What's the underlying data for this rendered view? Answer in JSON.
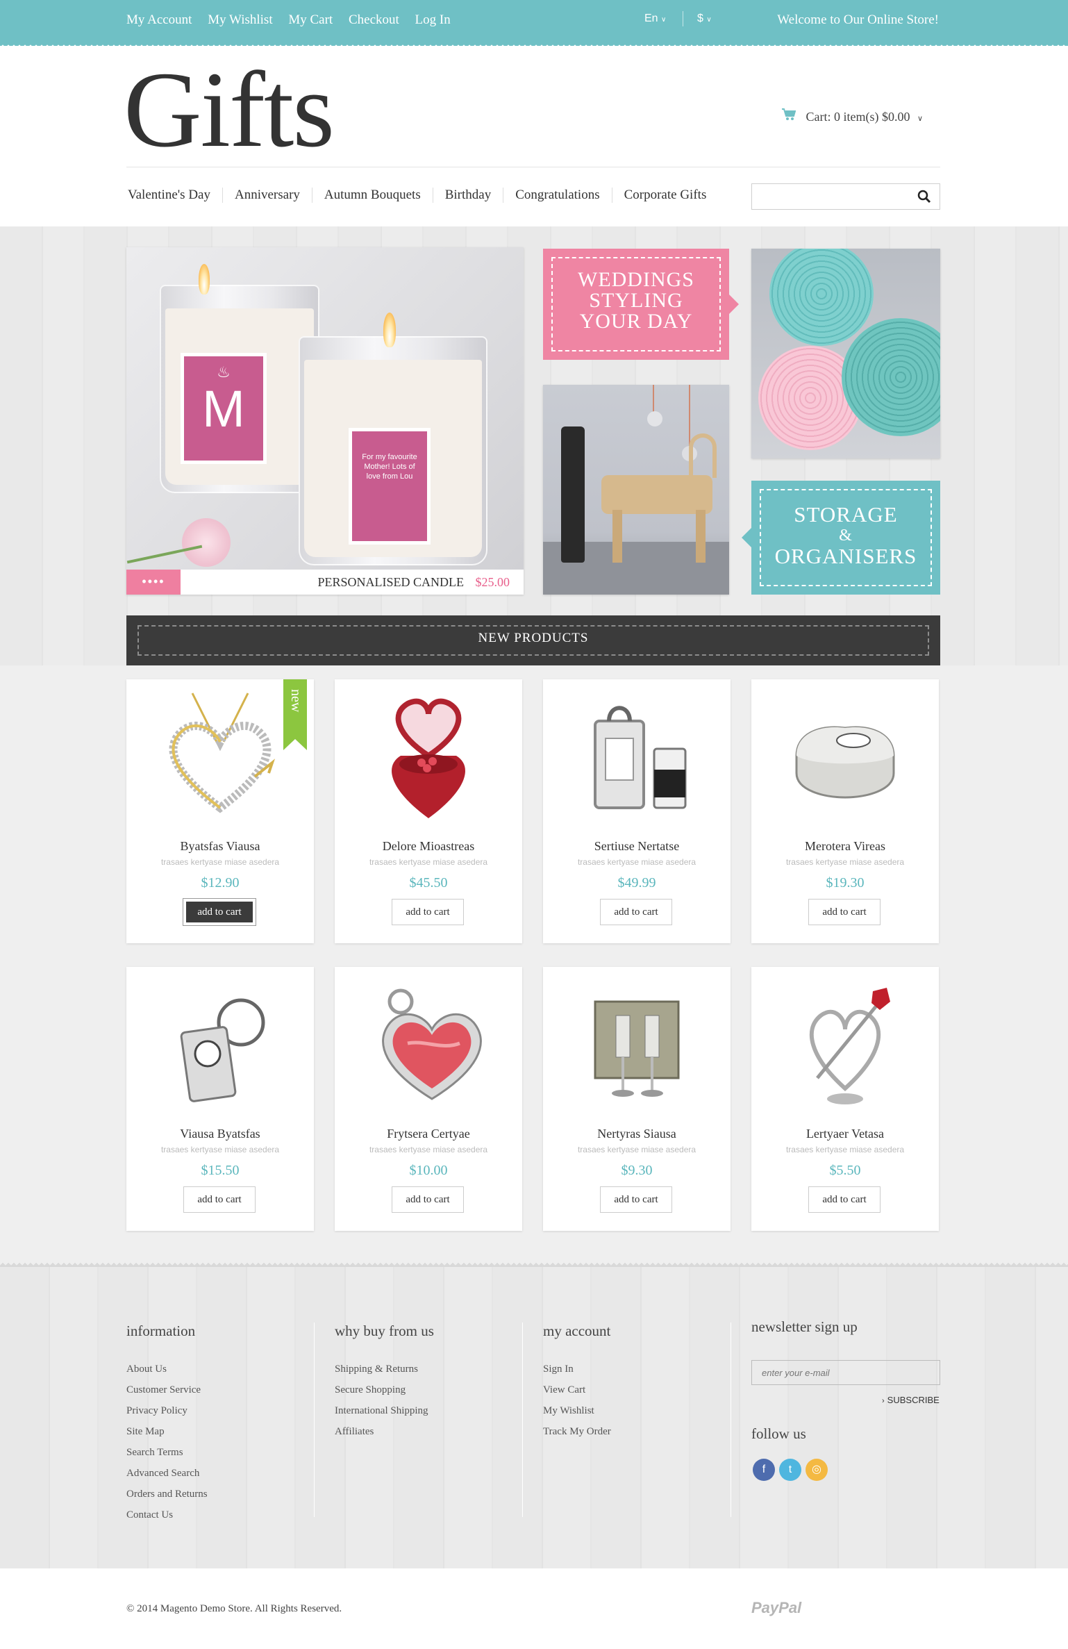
{
  "topbar": {
    "links": [
      "My Account",
      "My Wishlist",
      "My Cart",
      "Checkout",
      "Log In"
    ],
    "language": "En",
    "currency": "$",
    "welcome": "Welcome to Our Online Store!",
    "color": "#6fc0c5"
  },
  "header": {
    "logo": "Gifts",
    "cart": "Cart: 0 item(s) $0.00"
  },
  "nav": {
    "items": [
      "Valentine's Day",
      "Anniversary",
      "Autumn Bouquets",
      "Birthday",
      "Congratulations",
      "Corporate Gifts"
    ],
    "search_placeholder": ""
  },
  "hero": {
    "slider": {
      "dots": "••••",
      "caption": "PERSONALISED CANDLE",
      "price": "$25.00",
      "candle_big_label": "M",
      "candle_small_label": "For my favourite Mother! Lots of love from Lou"
    },
    "banner_weddings": [
      "WEDDINGS",
      "STYLING",
      "YOUR DAY"
    ],
    "banner_storage": [
      "STORAGE",
      "&",
      "ORGANISERS"
    ]
  },
  "new_products": {
    "title": "NEW PRODUCTS",
    "add_label": "add to cart",
    "badge_new": "new",
    "items": [
      {
        "name": "Byatsfas Viausa",
        "desc": "trasaes kertyase miase asedera",
        "price": "$12.90",
        "icon": "heart-pendant-icon"
      },
      {
        "name": "Delore Mioastreas",
        "desc": "trasaes kertyase miase asedera",
        "price": "$45.50",
        "icon": "heart-box-icon"
      },
      {
        "name": "Sertiuse Nertatse",
        "desc": "trasaes kertyase miase asedera",
        "price": "$49.99",
        "icon": "clock-icon"
      },
      {
        "name": "Merotera Vireas",
        "desc": "trasaes kertyase miase asedera",
        "price": "$19.30",
        "icon": "trinket-box-icon"
      },
      {
        "name": "Viausa Byatsfas",
        "desc": "trasaes kertyase miase asedera",
        "price": "$15.50",
        "icon": "keyring-clock-icon"
      },
      {
        "name": "Frytsera Certyae",
        "desc": "trasaes kertyase miase asedera",
        "price": "$10.00",
        "icon": "heart-gem-icon"
      },
      {
        "name": "Nertyras Siausa",
        "desc": "trasaes kertyase miase asedera",
        "price": "$9.30",
        "icon": "glasses-icon"
      },
      {
        "name": "Lertyaer Vetasa",
        "desc": "trasaes kertyase miase asedera",
        "price": "$5.50",
        "icon": "heart-rose-icon"
      }
    ]
  },
  "footer": {
    "information": {
      "title": "information",
      "items": [
        "About Us",
        "Customer Service",
        "Privacy Policy",
        "Site Map",
        "Search Terms",
        "Advanced Search",
        "Orders and Returns",
        "Contact Us"
      ]
    },
    "why": {
      "title": "why buy from us",
      "items": [
        "Shipping & Returns",
        "Secure Shopping",
        "International Shipping",
        "Affiliates"
      ]
    },
    "account": {
      "title": "my account",
      "items": [
        "Sign In",
        "View Cart",
        "My Wishlist",
        "Track My Order"
      ]
    },
    "newsletter": {
      "title": "newsletter sign up",
      "placeholder": "enter your e-mail",
      "subscribe": "SUBSCRIBE"
    },
    "follow": "follow us",
    "social": [
      {
        "icon": "facebook-icon",
        "glyph": "f",
        "color": "#4e6cae"
      },
      {
        "icon": "twitter-icon",
        "glyph": "t",
        "color": "#4fb6df"
      },
      {
        "icon": "rss-icon",
        "glyph": "◎",
        "color": "#f4b942"
      }
    ]
  },
  "bottom": {
    "copyright": "© 2014 Magento Demo Store. All Rights Reserved.",
    "paypal": "PayPal"
  }
}
